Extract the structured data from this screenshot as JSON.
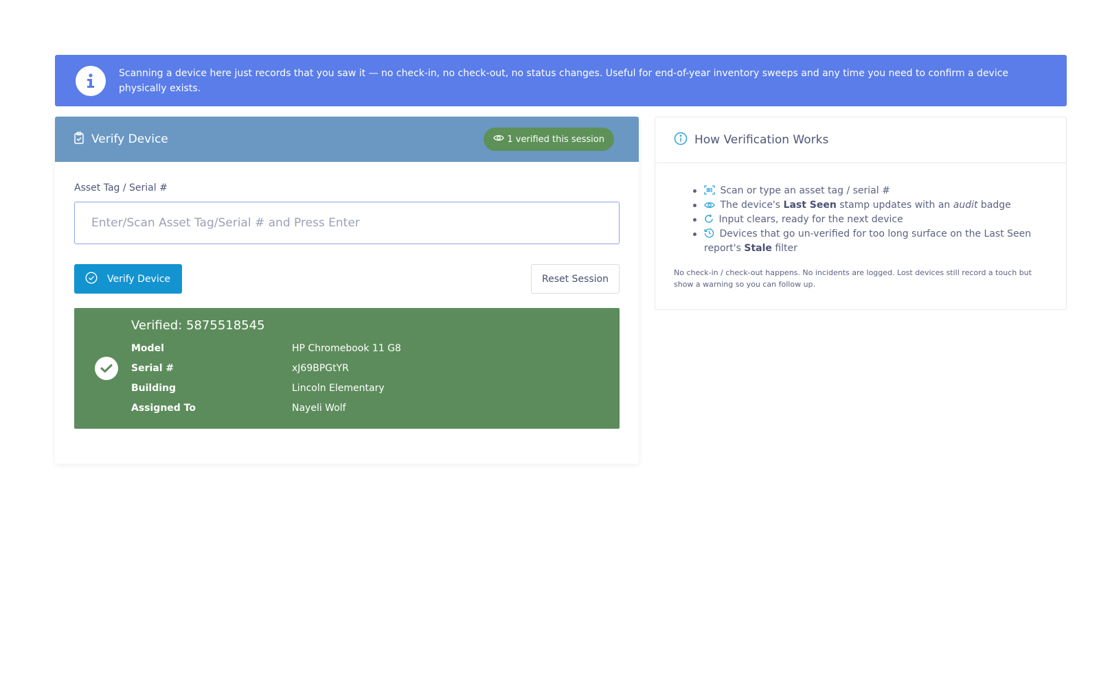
{
  "banner": {
    "icon": "info-icon",
    "text": "Scanning a device here just records that you saw it — no check-in, no check-out, no status changes. Useful for end-of-year inventory sweeps and any time you need to confirm a device physically exists."
  },
  "verify": {
    "title": "Verify Device",
    "title_icon": "clipboard-check-icon",
    "session_badge": "1 verified this session",
    "field_label": "Asset Tag / Serial #",
    "input_value": "",
    "input_placeholder": "Enter/Scan Asset Tag/Serial # and Press Enter",
    "verify_button": "Verify Device",
    "reset_button": "Reset Session",
    "result": {
      "title": "Verified: 5875518545",
      "rows": [
        {
          "label": "Model",
          "value": "HP Chromebook 11 G8"
        },
        {
          "label": "Serial #",
          "value": "xJ69BPGtYR"
        },
        {
          "label": "Building",
          "value": "Lincoln Elementary"
        },
        {
          "label": "Assigned To",
          "value": "Nayeli Wolf"
        }
      ]
    }
  },
  "how": {
    "title": "How Verification Works",
    "title_icon": "info-circle-icon",
    "steps": [
      {
        "icon": "barcode-scan-icon",
        "t1": "Scan or type an asset tag / serial #"
      },
      {
        "icon": "eye-icon",
        "t1": "The device's ",
        "b1": "Last Seen",
        "t2": " stamp updates with an ",
        "i1": "audit",
        "t3": " badge"
      },
      {
        "icon": "refresh-icon",
        "t1": "Input clears, ready for the next device"
      },
      {
        "icon": "history-icon",
        "t1": "Devices that go un-verified for too long surface on the Last Seen report's ",
        "b1": "Stale",
        "t2": " filter"
      }
    ],
    "note": "No check-in / check-out happens. No incidents are logged. Lost devices still record a touch but show a warning so you can follow up."
  },
  "colors": {
    "banner": "#5a7de9",
    "verify_header": "#6a98c3",
    "success": "#5c8c5b",
    "primary_button": "#1393d0",
    "icon_accent": "#2aa3d9"
  }
}
